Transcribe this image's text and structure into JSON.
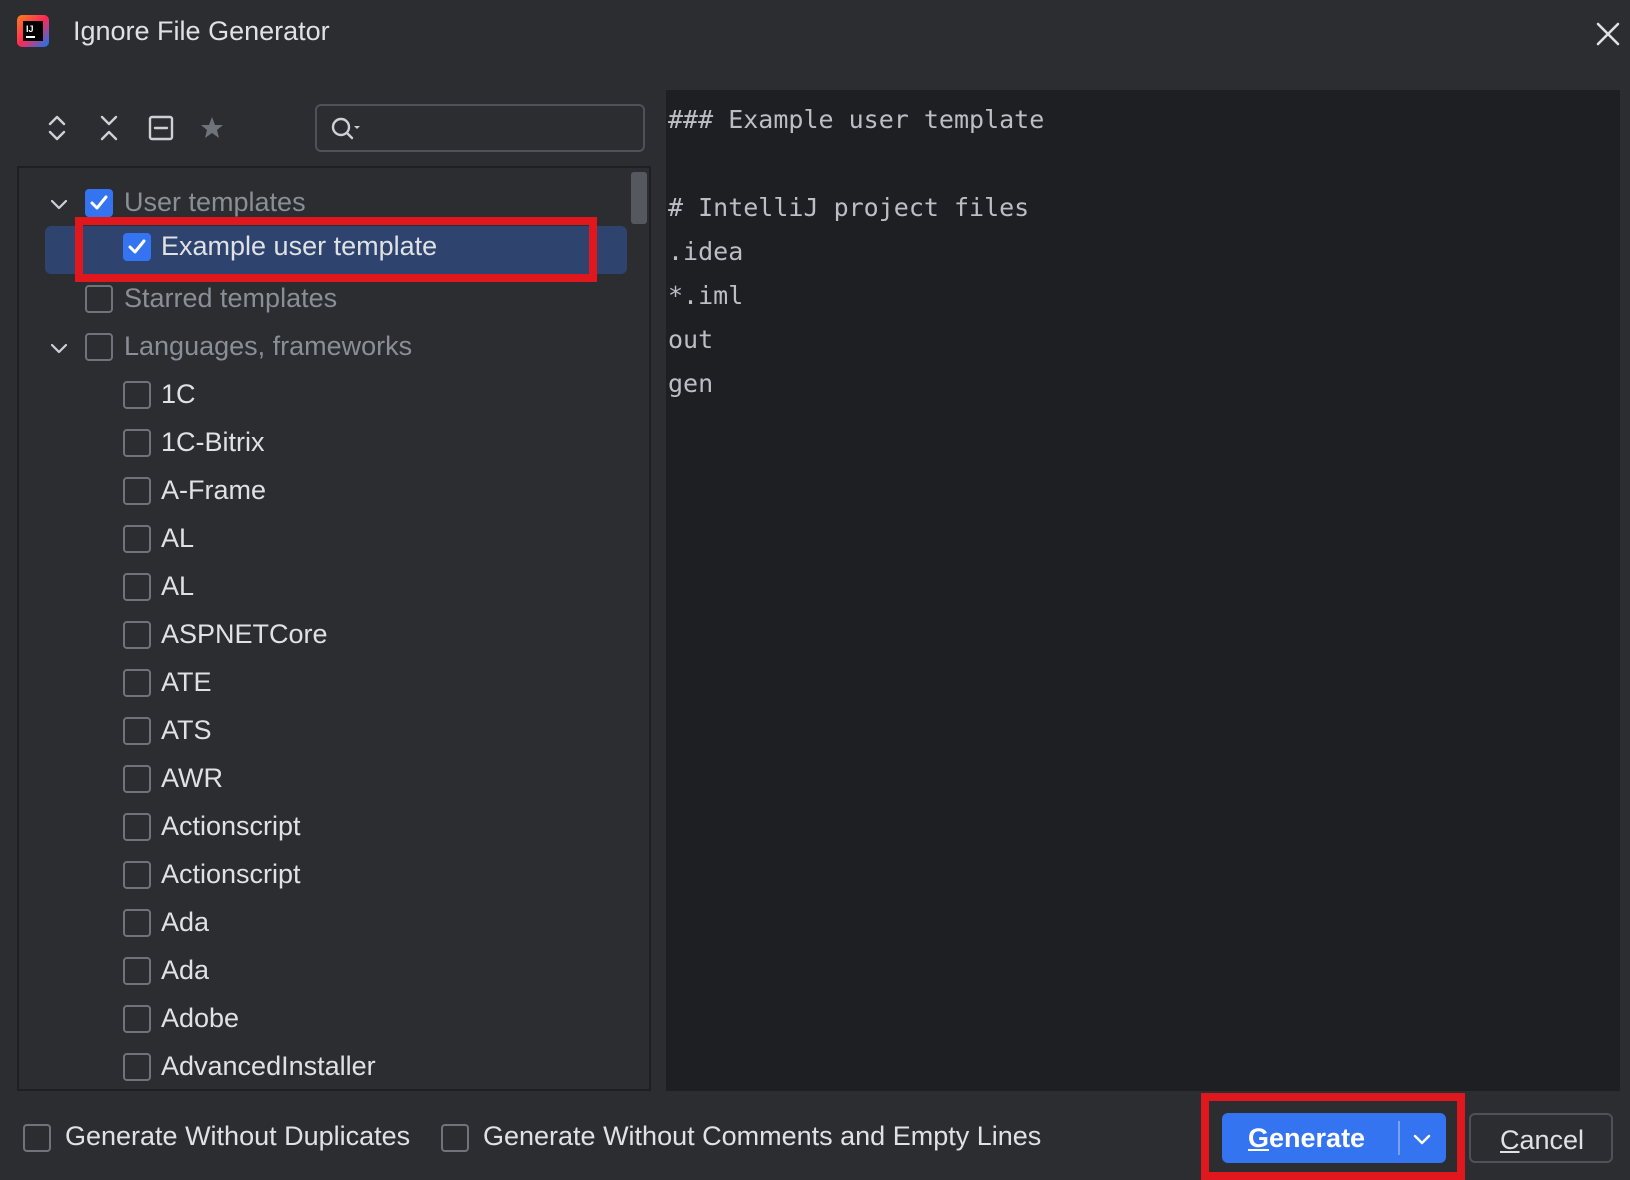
{
  "window": {
    "title": "Ignore File Generator",
    "close_icon": "close-icon",
    "logo_icon": "intellij-logo-icon"
  },
  "toolbar": {
    "icons": [
      "expand-all-icon",
      "collapse-all-icon",
      "collapse-icon",
      "star-icon"
    ],
    "search_value": "",
    "search_icon": "search-icon"
  },
  "tree": {
    "user_templates": {
      "label": "User templates",
      "checked": true,
      "expanded": true
    },
    "example_user_template": {
      "label": "Example user template",
      "checked": true,
      "selected": true
    },
    "starred_templates": {
      "label": "Starred templates",
      "checked": false
    },
    "languages": {
      "label": "Languages, frameworks",
      "checked": false,
      "expanded": true
    },
    "items": [
      "1C",
      "1C-Bitrix",
      "A-Frame",
      "AL",
      "AL",
      "ASPNETCore",
      "ATE",
      "ATS",
      "AWR",
      "Actionscript",
      "Actionscript",
      "Ada",
      "Ada",
      "Adobe",
      "AdvancedInstaller"
    ]
  },
  "preview": {
    "lines": [
      "### Example user template",
      "",
      "# IntelliJ project files",
      ".idea",
      "*.iml",
      "out",
      "gen"
    ]
  },
  "options": {
    "without_duplicates": {
      "label": "Generate Without Duplicates",
      "checked": false
    },
    "without_comments": {
      "label": "Generate Without Comments and Empty Lines",
      "checked": false
    }
  },
  "buttons": {
    "generate_mnemonic": "G",
    "generate_rest": "enerate",
    "cancel_mnemonic": "C",
    "cancel_rest": "ancel"
  },
  "colors": {
    "background": "#2b2d30",
    "editor_background": "#1e1f22",
    "accent": "#3574f0",
    "selection": "#2e436e",
    "highlight": "#e0181e"
  }
}
